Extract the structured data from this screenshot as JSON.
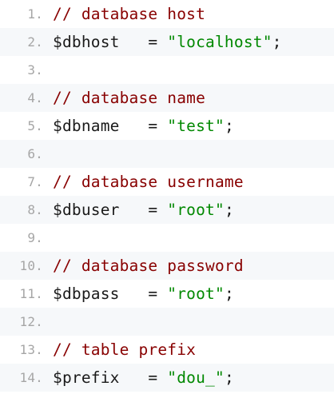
{
  "colors": {
    "comment": "#880000",
    "string": "#008800",
    "text": "#1a1a1a",
    "line_number": "#a6a6a6",
    "stripe": "#f6f8fa",
    "background": "#ffffff"
  },
  "lines": [
    {
      "number": "1.",
      "tokens": [
        {
          "type": "comment",
          "text": "// database host"
        }
      ]
    },
    {
      "number": "2.",
      "tokens": [
        {
          "type": "var",
          "text": "$dbhost"
        },
        {
          "type": "op",
          "text": "   = "
        },
        {
          "type": "string",
          "text": "\"localhost\""
        },
        {
          "type": "punct",
          "text": ";"
        }
      ]
    },
    {
      "number": "3.",
      "tokens": []
    },
    {
      "number": "4.",
      "tokens": [
        {
          "type": "comment",
          "text": "// database name"
        }
      ]
    },
    {
      "number": "5.",
      "tokens": [
        {
          "type": "var",
          "text": "$dbname"
        },
        {
          "type": "op",
          "text": "   = "
        },
        {
          "type": "string",
          "text": "\"test\""
        },
        {
          "type": "punct",
          "text": ";"
        }
      ]
    },
    {
      "number": "6.",
      "tokens": []
    },
    {
      "number": "7.",
      "tokens": [
        {
          "type": "comment",
          "text": "// database username"
        }
      ]
    },
    {
      "number": "8.",
      "tokens": [
        {
          "type": "var",
          "text": "$dbuser"
        },
        {
          "type": "op",
          "text": "   = "
        },
        {
          "type": "string",
          "text": "\"root\""
        },
        {
          "type": "punct",
          "text": ";"
        }
      ]
    },
    {
      "number": "9.",
      "tokens": []
    },
    {
      "number": "10.",
      "tokens": [
        {
          "type": "comment",
          "text": "// database password"
        }
      ]
    },
    {
      "number": "11.",
      "tokens": [
        {
          "type": "var",
          "text": "$dbpass"
        },
        {
          "type": "op",
          "text": "   = "
        },
        {
          "type": "string",
          "text": "\"root\""
        },
        {
          "type": "punct",
          "text": ";"
        }
      ]
    },
    {
      "number": "12.",
      "tokens": []
    },
    {
      "number": "13.",
      "tokens": [
        {
          "type": "comment",
          "text": "// table prefix"
        }
      ]
    },
    {
      "number": "14.",
      "tokens": [
        {
          "type": "var",
          "text": "$prefix"
        },
        {
          "type": "op",
          "text": "   = "
        },
        {
          "type": "string",
          "text": "\"dou_\""
        },
        {
          "type": "punct",
          "text": ";"
        }
      ]
    }
  ]
}
